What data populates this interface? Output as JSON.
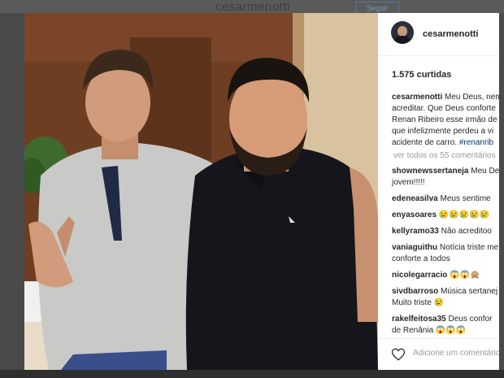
{
  "background": {
    "profile_name": "cesarmenotti",
    "follow_label": "Seguir"
  },
  "post": {
    "username": "cesarmenotti",
    "likes": "1.575 curtidas",
    "caption": {
      "author": "cesarmenotti",
      "lines": [
        "Meu Deus, nem",
        "acreditar. Que Deus conforte",
        "Renan Ribeiro esse irmão de",
        "que infelizmente perdeu a vi",
        "acidente de carro."
      ],
      "hashtag": "#renanrib"
    },
    "view_all": "ver todos os 55 comentários",
    "comments": [
      {
        "user": "shownewssertaneja",
        "text": "Meu De"
      },
      {
        "user": "",
        "text": "jovem!!!!!"
      },
      {
        "user": "edeneasilva",
        "text": "Meus sentime"
      },
      {
        "user": "enyasoares",
        "text": "😢😢😢😢😢"
      },
      {
        "user": "kellyramo33",
        "text": "Não acreditoo"
      },
      {
        "user": "vaniaguithu",
        "text": "Notícia triste me"
      },
      {
        "user": "",
        "text": "conforte a todos"
      },
      {
        "user": "nicolegarracio",
        "text": "😱😱🙊"
      },
      {
        "user": "sivdbarroso",
        "text": "Música sertanej"
      },
      {
        "user": "",
        "text": "Muito triste 😢"
      },
      {
        "user": "rakelfeitosa35",
        "text": "Deus confor"
      },
      {
        "user": "",
        "text": "de Renânia 😱😱😱"
      }
    ],
    "add_comment_placeholder": "Adicione um comentário"
  }
}
